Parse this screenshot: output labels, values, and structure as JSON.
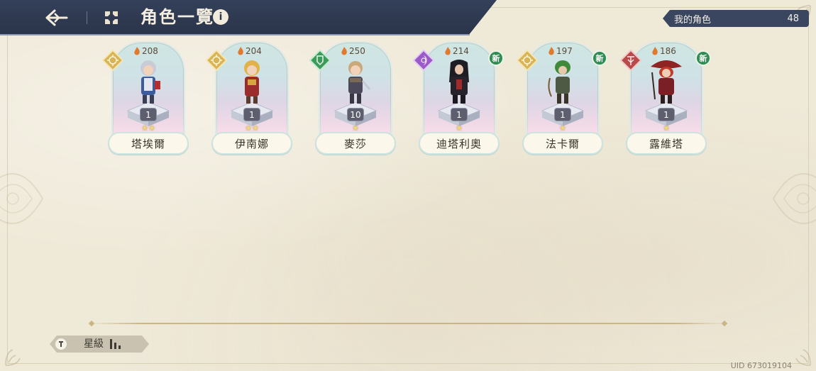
{
  "header": {
    "title": "角色一覽",
    "back_icon": "back-arrow-icon",
    "grid_icon": "grid-view-icon",
    "info_glyph": "i"
  },
  "counter": {
    "label": "我的角色",
    "value": "48"
  },
  "characters": [
    {
      "name": "塔埃爾",
      "power": "208",
      "level": "1",
      "stars": "★★",
      "element": "light",
      "new": false
    },
    {
      "name": "伊南娜",
      "power": "204",
      "level": "1",
      "stars": "★★",
      "element": "light",
      "new": false
    },
    {
      "name": "麥莎",
      "power": "250",
      "level": "10",
      "stars": "★",
      "element": "earth",
      "new": false
    },
    {
      "name": "迪塔利奧",
      "power": "214",
      "level": "1",
      "stars": "★",
      "element": "dark",
      "new": true
    },
    {
      "name": "法卡爾",
      "power": "197",
      "level": "1",
      "stars": "★",
      "element": "light",
      "new": true
    },
    {
      "name": "露維塔",
      "power": "186",
      "level": "1",
      "stars": "★",
      "element": "fire",
      "new": true
    }
  ],
  "new_label": "新",
  "sort": {
    "label": "星級",
    "icon": "sort-toggle-icon"
  },
  "uid": "UID 673019104",
  "colors": {
    "header_bg": "#2a3449",
    "paper": "#efe9d8",
    "new_badge": "#2f8b52",
    "light_element": "#d9b457",
    "earth_element": "#3c9b5a",
    "dark_element": "#9a5bc9",
    "fire_element": "#b84a4a"
  }
}
